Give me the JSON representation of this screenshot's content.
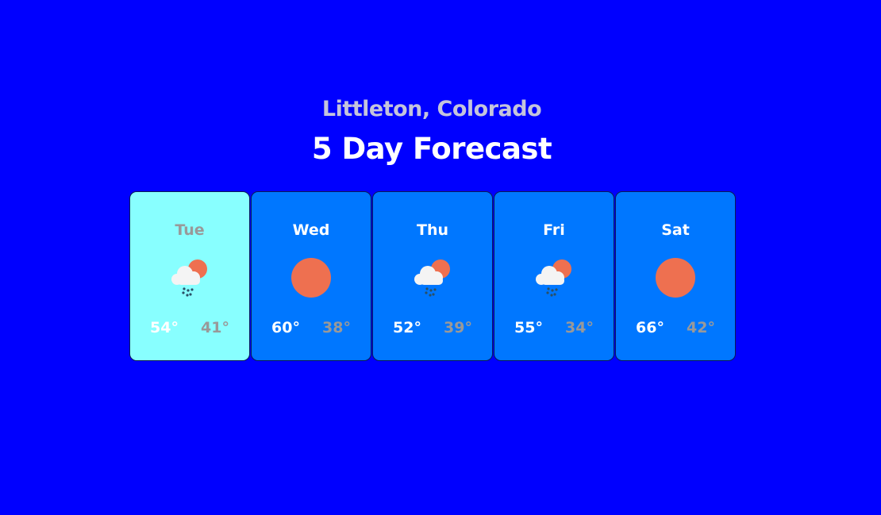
{
  "header": {
    "location": "Littleton, Colorado",
    "title": "5 Day Forecast"
  },
  "colors": {
    "background": "#0000ff",
    "card": "#0077ff",
    "card_selected": "#88ffff",
    "sun": "#ee7050"
  },
  "days": [
    {
      "day": "Tue",
      "icon": "rain-cloud-sun-icon",
      "high": "54°",
      "low": "41°",
      "selected": true
    },
    {
      "day": "Wed",
      "icon": "sun-icon",
      "high": "60°",
      "low": "38°",
      "selected": false
    },
    {
      "day": "Thu",
      "icon": "rain-cloud-sun-icon",
      "high": "52°",
      "low": "39°",
      "selected": false
    },
    {
      "day": "Fri",
      "icon": "rain-cloud-sun-icon",
      "high": "55°",
      "low": "34°",
      "selected": false
    },
    {
      "day": "Sat",
      "icon": "sun-icon",
      "high": "66°",
      "low": "42°",
      "selected": false
    }
  ]
}
